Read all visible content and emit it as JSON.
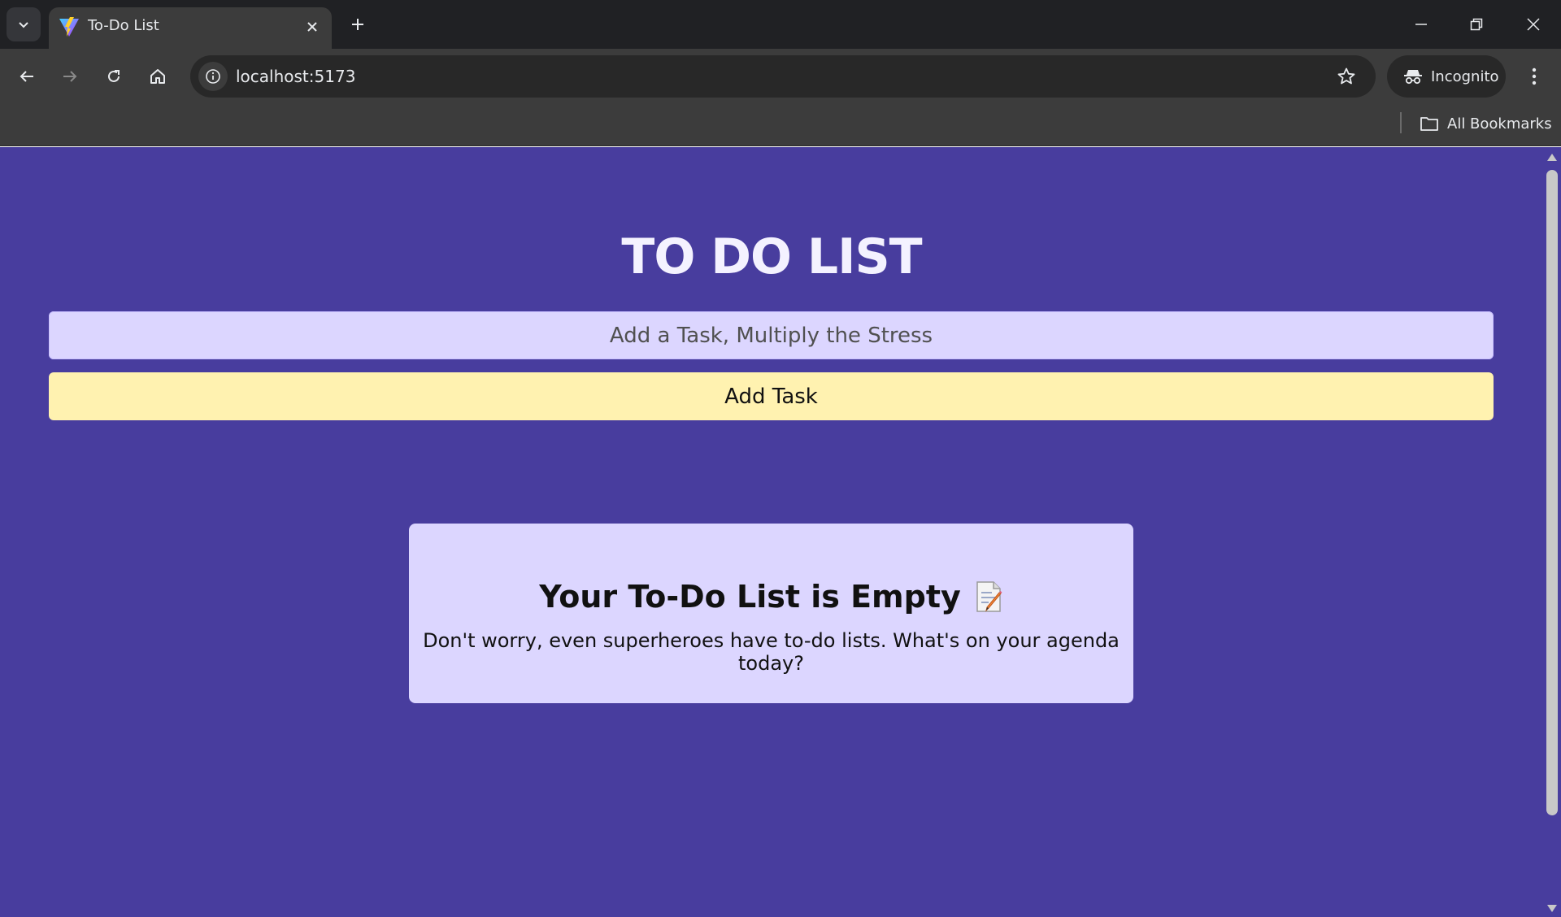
{
  "browser": {
    "tab": {
      "title": "To-Do List"
    },
    "address_bar": {
      "url": "localhost:5173"
    },
    "profile": {
      "label": "Incognito"
    },
    "bookmarks_bar": {
      "all_bookmarks_label": "All Bookmarks"
    },
    "colors": {
      "frame": "#202124",
      "toolbar": "#3c3c3c",
      "omnibox": "#282828"
    }
  },
  "app": {
    "title": "TO DO LIST",
    "input": {
      "placeholder": "Add a Task, Multiply the Stress",
      "value": ""
    },
    "add_button_label": "Add Task",
    "empty_state": {
      "title": "Your To-Do List is Empty",
      "icon": "memo-icon",
      "subtitle": "Don't worry, even superheroes have to-do lists. What's on your agenda today?"
    },
    "colors": {
      "background": "#483d9e",
      "input_bg": "#dcd6ff",
      "button_bg": "#fff2b0",
      "card_bg": "#dcd6ff"
    }
  }
}
